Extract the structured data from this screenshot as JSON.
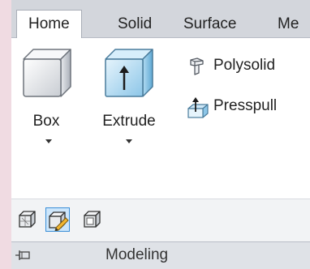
{
  "tabs": [
    {
      "label": "Home",
      "active": true
    },
    {
      "label": "Solid",
      "active": false
    },
    {
      "label": "Surface",
      "active": false
    },
    {
      "label": "Me",
      "active": false
    }
  ],
  "panel": {
    "title": "Modeling",
    "large_buttons": [
      {
        "label": "Box",
        "icon": "box-icon",
        "has_dropdown": true
      },
      {
        "label": "Extrude",
        "icon": "extrude-icon",
        "has_dropdown": true
      }
    ],
    "small_buttons": [
      {
        "label": "Polysolid",
        "icon": "polysolid-icon"
      },
      {
        "label": "Presspull",
        "icon": "presspull-icon"
      }
    ],
    "icon_row": [
      {
        "icon": "smooth-object-icon",
        "selected": false
      },
      {
        "icon": "edit-solid-icon",
        "selected": true
      },
      {
        "icon": "solid-box-icon",
        "selected": false
      }
    ]
  },
  "colors": {
    "background": "#f0dbe2",
    "ribbon": "#ffffff",
    "tab_strip": "#d3d6dc",
    "selection_fill": "#cde6fb",
    "selection_border": "#3a8fd8"
  }
}
